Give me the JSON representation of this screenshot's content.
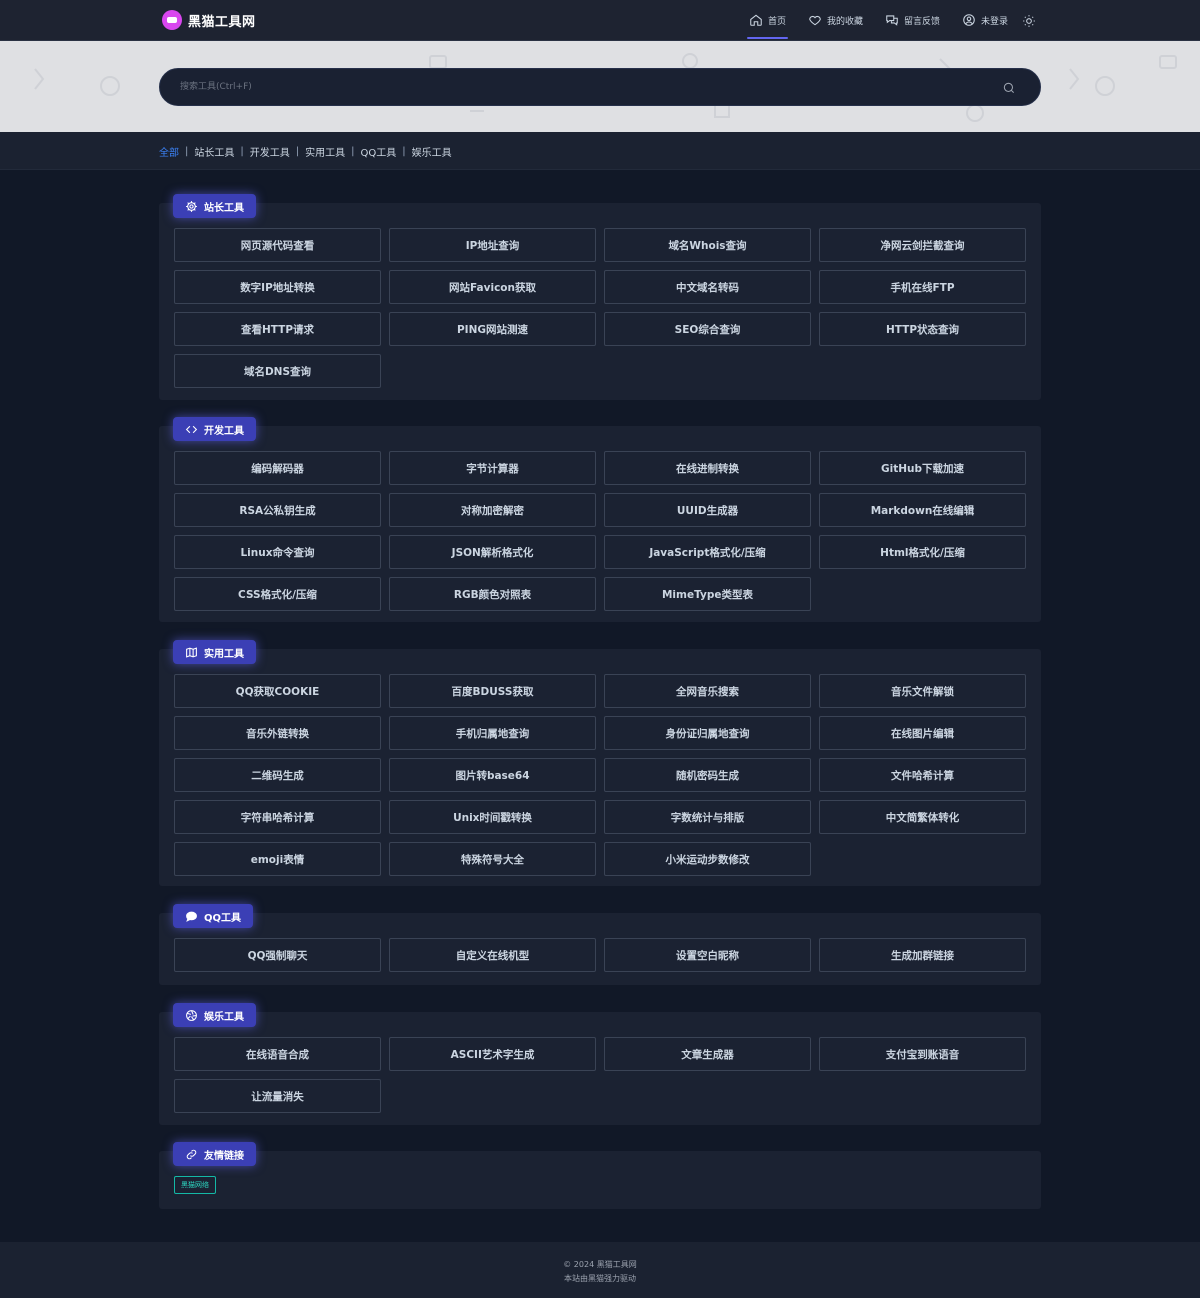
{
  "header": {
    "logo_text": "黑猫工具网",
    "nav": [
      {
        "label": "首页",
        "icon": "home-icon"
      },
      {
        "label": "我的收藏",
        "icon": "heart-icon"
      },
      {
        "label": "留言反馈",
        "icon": "chat-icon"
      },
      {
        "label": "未登录",
        "icon": "user-icon"
      }
    ],
    "theme_icon": "sun-icon"
  },
  "search": {
    "placeholder": "搜索工具(Ctrl+F)",
    "icon": "search-icon"
  },
  "categories": [
    "全部",
    "站长工具",
    "开发工具",
    "实用工具",
    "QQ工具",
    "娱乐工具"
  ],
  "sections": [
    {
      "title": "站长工具",
      "icon": "gear-icon",
      "tools": [
        "网页源代码查看",
        "IP地址查询",
        "域名Whois查询",
        "净网云剑拦截查询",
        "数字IP地址转换",
        "网站Favicon获取",
        "中文域名转码",
        "手机在线FTP",
        "查看HTTP请求",
        "PING网站测速",
        "SEO综合查询",
        "HTTP状态查询",
        "域名DNS查询"
      ]
    },
    {
      "title": "开发工具",
      "icon": "code-icon",
      "tools": [
        "编码解码器",
        "字节计算器",
        "在线进制转换",
        "GitHub下载加速",
        "RSA公私钥生成",
        "对称加密解密",
        "UUID生成器",
        "Markdown在线编辑",
        "Linux命令查询",
        "JSON解析格式化",
        "JavaScript格式化/压缩",
        "Html格式化/压缩",
        "CSS格式化/压缩",
        "RGB颜色对照表",
        "MimeType类型表"
      ]
    },
    {
      "title": "实用工具",
      "icon": "map-icon",
      "tools": [
        "QQ获取COOKIE",
        "百度BDUSS获取",
        "全网音乐搜索",
        "音乐文件解锁",
        "音乐外链转换",
        "手机归属地查询",
        "身份证归属地查询",
        "在线图片编辑",
        "二维码生成",
        "图片转base64",
        "随机密码生成",
        "文件哈希计算",
        "字符串哈希计算",
        "Unix时间戳转换",
        "字数统计与排版",
        "中文简繁体转化",
        "emoji表情",
        "特殊符号大全",
        "小米运动步数修改"
      ]
    },
    {
      "title": "QQ工具",
      "icon": "message-icon",
      "tools": [
        "QQ强制聊天",
        "自定义在线机型",
        "设置空白昵称",
        "生成加群链接"
      ]
    },
    {
      "title": "娱乐工具",
      "icon": "aperture-icon",
      "tools": [
        "在线语音合成",
        "ASCII艺术字生成",
        "文章生成器",
        "支付宝到账语音",
        "让流量消失"
      ]
    }
  ],
  "friends": {
    "title": "友情链接",
    "icon": "link-icon",
    "links": [
      "黑猫网络"
    ]
  },
  "footer": {
    "line1": "© 2024 黑猫工具网",
    "line2": "本站由黑猫强力驱动"
  },
  "colors": {
    "accent": "#3b3fb5",
    "link_active": "#3b82f6",
    "friend": "#2dd4bf",
    "bg": "#111827",
    "panel": "#1b2232"
  }
}
